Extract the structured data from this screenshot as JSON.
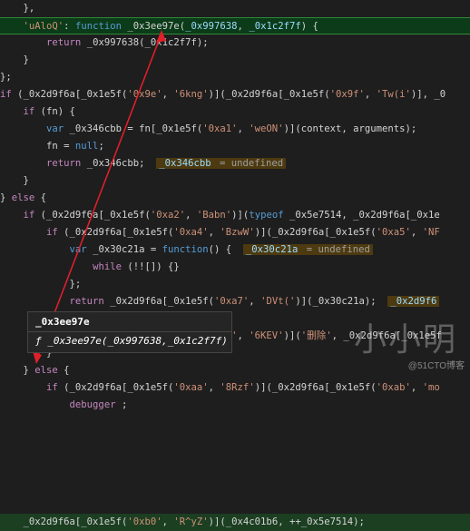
{
  "editor": {
    "lines": [
      [
        {
          "t": "    },",
          "c": "plain"
        }
      ],
      [
        {
          "t": "    ",
          "c": "plain"
        },
        {
          "t": "'uAloQ'",
          "c": "str"
        },
        {
          "t": ": ",
          "c": "plain"
        },
        {
          "t": "function",
          "c": "kw"
        },
        {
          "t": " _0x3ee97e(",
          "c": "plain"
        },
        {
          "t": "_0x997638",
          "c": "var"
        },
        {
          "t": ", ",
          "c": "plain"
        },
        {
          "t": "_0x1c2f7f",
          "c": "var"
        },
        {
          "t": ") {",
          "c": "plain"
        }
      ],
      [
        {
          "t": "        ",
          "c": "plain"
        },
        {
          "t": "return",
          "c": "ctl"
        },
        {
          "t": " _0x997638(_0x1c2f7f);",
          "c": "plain"
        }
      ],
      [
        {
          "t": "    }",
          "c": "plain"
        }
      ],
      [
        {
          "t": "};",
          "c": "plain"
        }
      ],
      [
        {
          "t": "if",
          "c": "ctl"
        },
        {
          "t": " (_0x2d9f6a[_0x1e5f(",
          "c": "plain"
        },
        {
          "t": "'0x9e'",
          "c": "str"
        },
        {
          "t": ", ",
          "c": "plain"
        },
        {
          "t": "'6kng'",
          "c": "str"
        },
        {
          "t": ")](_0x2d9f6a[_0x1e5f(",
          "c": "plain"
        },
        {
          "t": "'0x9f'",
          "c": "str"
        },
        {
          "t": ", ",
          "c": "plain"
        },
        {
          "t": "'Tw(i'",
          "c": "str"
        },
        {
          "t": ")], _0",
          "c": "plain"
        }
      ],
      [
        {
          "t": "    ",
          "c": "plain"
        },
        {
          "t": "if",
          "c": "ctl"
        },
        {
          "t": " (fn) {",
          "c": "plain"
        }
      ],
      [
        {
          "t": "        ",
          "c": "plain"
        },
        {
          "t": "var",
          "c": "kw"
        },
        {
          "t": " _0x346cbb = fn[_0x1e5f(",
          "c": "plain"
        },
        {
          "t": "'0xa1'",
          "c": "str"
        },
        {
          "t": ", ",
          "c": "plain"
        },
        {
          "t": "'weON'",
          "c": "str"
        },
        {
          "t": ")](context, arguments);",
          "c": "plain"
        }
      ],
      [
        {
          "t": "        fn = ",
          "c": "plain"
        },
        {
          "t": "null",
          "c": "kw"
        },
        {
          "t": ";",
          "c": "plain"
        }
      ],
      [
        {
          "t": "        ",
          "c": "plain"
        },
        {
          "t": "return",
          "c": "ctl"
        },
        {
          "t": " _0x346cbb;  ",
          "c": "plain"
        },
        {
          "t": "_0x346cbb",
          "c": "inl-v"
        },
        {
          "t": " = undefined",
          "c": "inl-u"
        }
      ],
      [
        {
          "t": "    }",
          "c": "plain"
        }
      ],
      [
        {
          "t": "} ",
          "c": "plain"
        },
        {
          "t": "else",
          "c": "ctl"
        },
        {
          "t": " {",
          "c": "plain"
        }
      ],
      [
        {
          "t": "    ",
          "c": "plain"
        },
        {
          "t": "if",
          "c": "ctl"
        },
        {
          "t": " (_0x2d9f6a[_0x1e5f(",
          "c": "plain"
        },
        {
          "t": "'0xa2'",
          "c": "str"
        },
        {
          "t": ", ",
          "c": "plain"
        },
        {
          "t": "'Babn'",
          "c": "str"
        },
        {
          "t": ")](",
          "c": "plain"
        },
        {
          "t": "typeof",
          "c": "kw"
        },
        {
          "t": " _0x5e7514, _0x2d9f6a[_0x1e",
          "c": "plain"
        }
      ],
      [
        {
          "t": "        ",
          "c": "plain"
        },
        {
          "t": "if",
          "c": "ctl"
        },
        {
          "t": " (_0x2d9f6a[_0x1e5f(",
          "c": "plain"
        },
        {
          "t": "'0xa4'",
          "c": "str"
        },
        {
          "t": ", ",
          "c": "plain"
        },
        {
          "t": "'BzwW'",
          "c": "str"
        },
        {
          "t": ")](_0x2d9f6a[_0x1e5f(",
          "c": "plain"
        },
        {
          "t": "'0xa5'",
          "c": "str"
        },
        {
          "t": ", ",
          "c": "plain"
        },
        {
          "t": "'NF",
          "c": "str"
        }
      ],
      [
        {
          "t": "            ",
          "c": "plain"
        },
        {
          "t": "var",
          "c": "kw"
        },
        {
          "t": " _0x30c21a = ",
          "c": "plain"
        },
        {
          "t": "function",
          "c": "kw"
        },
        {
          "t": "() {  ",
          "c": "plain"
        },
        {
          "t": "_0x30c21a",
          "c": "inl-v"
        },
        {
          "t": " = undefined",
          "c": "inl-u"
        }
      ],
      [
        {
          "t": "                ",
          "c": "plain"
        },
        {
          "t": "while",
          "c": "ctl"
        },
        {
          "t": " (!![]) {}",
          "c": "plain"
        }
      ],
      [
        {
          "t": "            };",
          "c": "plain"
        }
      ],
      [
        {
          "t": "            ",
          "c": "plain"
        },
        {
          "t": "return",
          "c": "ctl"
        },
        {
          "t": " _0x2d9f6a[_0x1e5f(",
          "c": "plain"
        },
        {
          "t": "'0xa7'",
          "c": "str"
        },
        {
          "t": ", ",
          "c": "plain"
        },
        {
          "t": "'DVt('",
          "c": "str"
        },
        {
          "t": ")](_0x30c21a);  ",
          "c": "plain"
        },
        {
          "t": "_0x2d9f6",
          "c": "inl-v"
        }
      ],
      [
        {
          "t": "        } ",
          "c": "plain"
        },
        {
          "t": "else",
          "c": "ctl"
        },
        {
          "t": " {",
          "c": "plain"
        }
      ],
      [
        {
          "t": "            w[",
          "c": "plain"
        },
        {
          "t": "c",
          "c": "box"
        },
        {
          "t": "](_0x2d9f6a[_0x1e5f(",
          "c": "plain"
        },
        {
          "t": "'0xa8'",
          "c": "str"
        },
        {
          "t": ", ",
          "c": "plain"
        },
        {
          "t": "'6KEV'",
          "c": "str"
        },
        {
          "t": ")](",
          "c": "plain"
        },
        {
          "t": "'删除'",
          "c": "str"
        },
        {
          "t": ", _0x2d9f6a[_0x1e5f",
          "c": "plain"
        }
      ],
      [
        {
          "t": "        }",
          "c": "plain"
        }
      ],
      [
        {
          "t": "    } ",
          "c": "plain"
        },
        {
          "t": "else",
          "c": "ctl"
        },
        {
          "t": " {",
          "c": "plain"
        }
      ],
      [
        {
          "t": "        ",
          "c": "plain"
        },
        {
          "t": "if",
          "c": "ctl"
        },
        {
          "t": " (_0x2d9f6a[_0x1e5f(",
          "c": "plain"
        },
        {
          "t": "'0xaa'",
          "c": "str"
        },
        {
          "t": ", ",
          "c": "plain"
        },
        {
          "t": "'8Rzf'",
          "c": "str"
        },
        {
          "t": ")](_0x2d9f6a[_0x1e5f(",
          "c": "plain"
        },
        {
          "t": "'0xab'",
          "c": "str"
        },
        {
          "t": ", ",
          "c": "plain"
        },
        {
          "t": "'mo",
          "c": "str"
        }
      ],
      [
        {
          "t": "            ",
          "c": "plain"
        },
        {
          "t": "debugger",
          "c": "ctl"
        },
        {
          "t": " ;",
          "c": "plain"
        }
      ],
      [
        {
          "t": "",
          "c": "plain"
        }
      ],
      [
        {
          "t": "",
          "c": "plain"
        }
      ],
      [
        {
          "t": "",
          "c": "plain"
        }
      ],
      [
        {
          "t": "",
          "c": "plain"
        }
      ],
      [
        {
          "t": "",
          "c": "plain"
        }
      ],
      [
        {
          "t": "",
          "c": "plain"
        }
      ],
      [
        {
          "t": "    ",
          "c": "plain"
        },
        {
          "t": "_0x2d9f6a[_0x1e5f(",
          "c": "plain"
        },
        {
          "t": "'0xb0'",
          "c": "str"
        },
        {
          "t": ", ",
          "c": "plain"
        },
        {
          "t": "'R^yZ'",
          "c": "str"
        },
        {
          "t": ")](_0x4c01b6, ++_0x5e7514);",
          "c": "plain"
        }
      ]
    ]
  },
  "tooltip": {
    "title": "_0x3ee97e",
    "signature": "ƒ _0x3ee97e(_0x997638,_0x1c2f7f)"
  },
  "watermark": {
    "text": "小小明",
    "url": "@51CTO博客"
  },
  "colors": {
    "arrow": "#e0202a",
    "highlight_line": "#0b3b18"
  }
}
